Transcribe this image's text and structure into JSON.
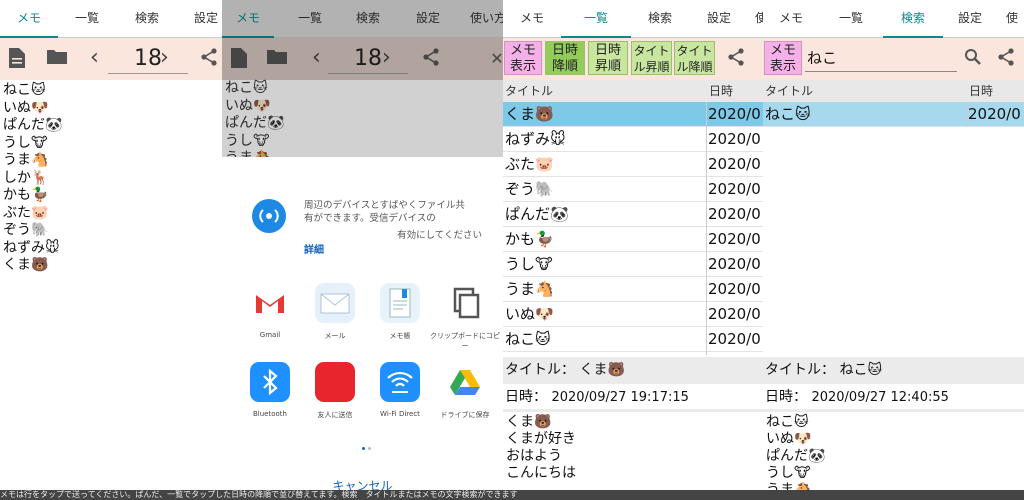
{
  "tabs": {
    "memo": "メモ",
    "list": "一覧",
    "search": "検索",
    "settings": "設定",
    "usage": "使い方",
    "usage_short": "使"
  },
  "toolbar": {
    "page": "18"
  },
  "memo_lines": [
    "ねこ🐱",
    "いぬ🐶",
    "ぱんだ🐼",
    "うし🐮",
    "うま🐴",
    "しか🦌",
    "かも🦆",
    "ぶた🐷",
    "ぞう🐘",
    "ねずみ🐭",
    "くま🐻"
  ],
  "share": {
    "nearby_text": "周辺のデバイスとすばやくファイル共有ができます。受信デバイスの",
    "nearby_text2": "有効にしてください",
    "details": "詳細",
    "apps": [
      {
        "name": "Gmail",
        "color": "#ffffff"
      },
      {
        "name": "メール",
        "color": "#e6f0fa"
      },
      {
        "name": "メモ帳",
        "color": "#e8f2fb"
      },
      {
        "name": "クリップボードにコピー",
        "color": "#ffffff"
      },
      {
        "name": "Bluetooth",
        "color": "#1e90ff"
      },
      {
        "name": "友人に送信",
        "color": "#e8242c"
      },
      {
        "name": "Wi-Fi Direct",
        "color": "#1e90ff"
      },
      {
        "name": "ドライブに保存",
        "color": "#ffffff"
      }
    ],
    "cancel": "キャンセル"
  },
  "list_buttons": {
    "memo_show": [
      "メモ",
      "表示"
    ],
    "date_desc": [
      "日時",
      "降順"
    ],
    "date_asc": [
      "日時",
      "昇順"
    ],
    "title_asc": [
      "タイト",
      "ル昇順"
    ],
    "title_desc": [
      "タイト",
      "ル降順"
    ]
  },
  "table": {
    "col_title": "タイトル",
    "col_date": "日時",
    "rows": [
      {
        "title": "くま🐻",
        "date": "2020/0",
        "selected": true
      },
      {
        "title": "ねずみ🐭",
        "date": "2020/0"
      },
      {
        "title": "ぶた🐷",
        "date": "2020/0"
      },
      {
        "title": "ぞう🐘",
        "date": "2020/0"
      },
      {
        "title": "ぱんだ🐼",
        "date": "2020/0"
      },
      {
        "title": "かも🦆",
        "date": "2020/0"
      },
      {
        "title": "うし🐮",
        "date": "2020/0"
      },
      {
        "title": "うま🐴",
        "date": "2020/0"
      },
      {
        "title": "いぬ🐶",
        "date": "2020/0"
      },
      {
        "title": "ねこ🐱",
        "date": "2020/0"
      }
    ]
  },
  "detail_left": {
    "title_label": "タイトル：",
    "title": "くま🐻",
    "date_label": "日時：",
    "date": "2020/09/27 19:17:15",
    "body": [
      "くま🐻",
      "くまが好き",
      "おはよう",
      "こんにちは"
    ]
  },
  "search": {
    "query": "ねこ",
    "row": {
      "title": "ねこ🐱",
      "date": "2020/0"
    }
  },
  "detail_right": {
    "title_label": "タイトル：",
    "title": "ねこ🐱",
    "date_label": "日時：",
    "date": "2020/09/27 12:40:55",
    "body": [
      "ねこ🐱",
      "いぬ🐶",
      "ぱんだ🐼",
      "うし🐮",
      "うま🐴"
    ]
  },
  "bottom_text": "メモは行をタップで送ってください。ぱんだ、一覧でタップした日時の降順で並び替えてます。検索　タイトルまたはメモの文字検索ができます"
}
